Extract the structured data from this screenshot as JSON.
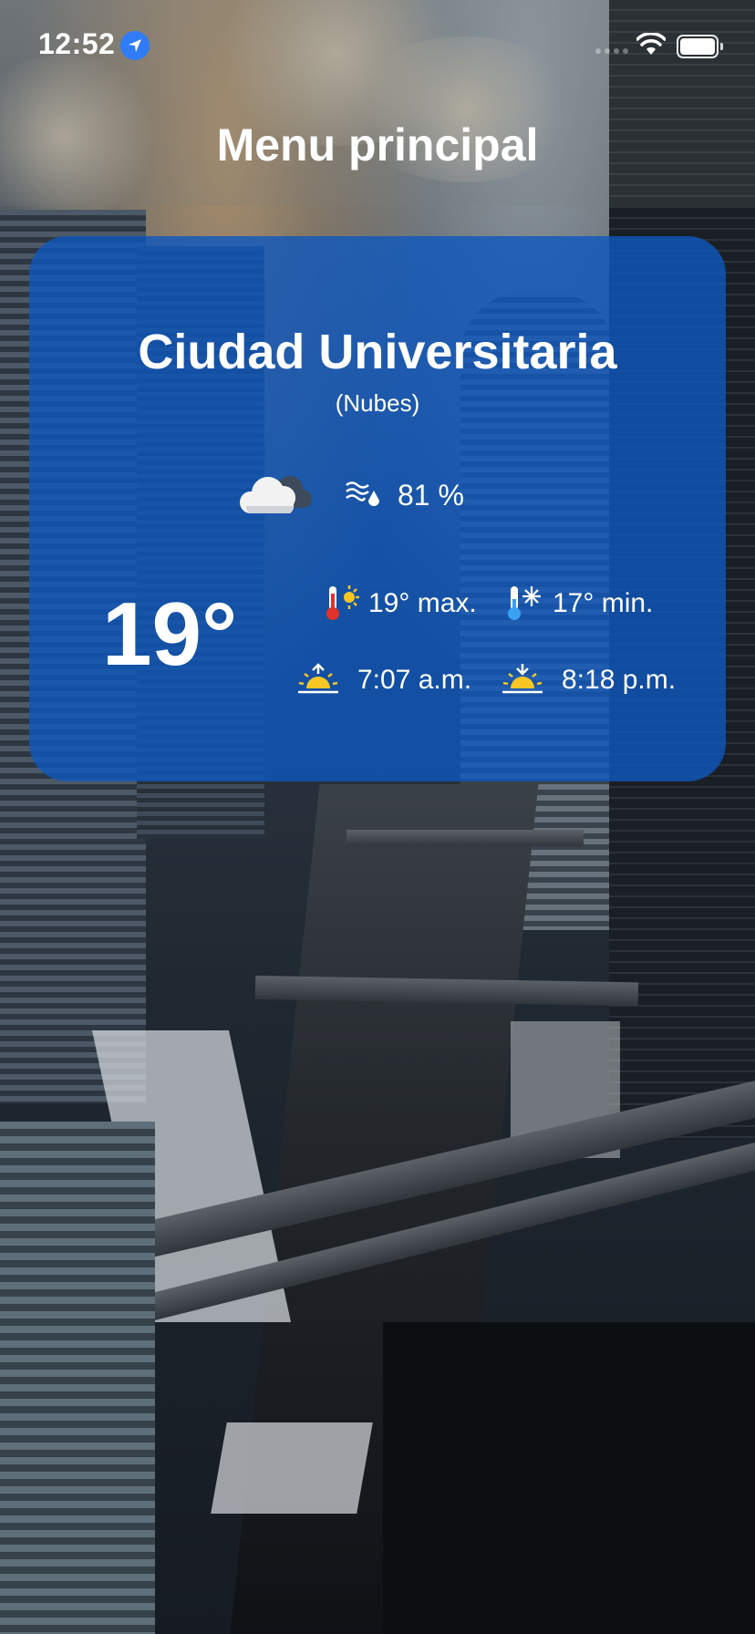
{
  "status_bar": {
    "time": "12:52"
  },
  "nav": {
    "title": "Menu principal"
  },
  "weather": {
    "city": "Ciudad Universitaria",
    "description": "(Nubes)",
    "humidity": "81 %",
    "temperature": "19°",
    "max": "19° max.",
    "min": "17° min.",
    "sunrise": "7:07 a.m.",
    "sunset": "8:18 p.m."
  },
  "icons": {
    "location": "location-arrow-icon",
    "signal": "cellular-signal-icon",
    "wifi": "wifi-icon",
    "battery": "battery-icon",
    "condition": "cloud-weather-icon",
    "humidity": "humidity-icon",
    "max": "thermometer-hot-icon",
    "min": "thermometer-cold-icon",
    "sunrise": "sunrise-icon",
    "sunset": "sunset-icon"
  },
  "colors": {
    "card": "#0e57be",
    "location_badge": "#2f7cf6",
    "text": "#ffffff"
  }
}
